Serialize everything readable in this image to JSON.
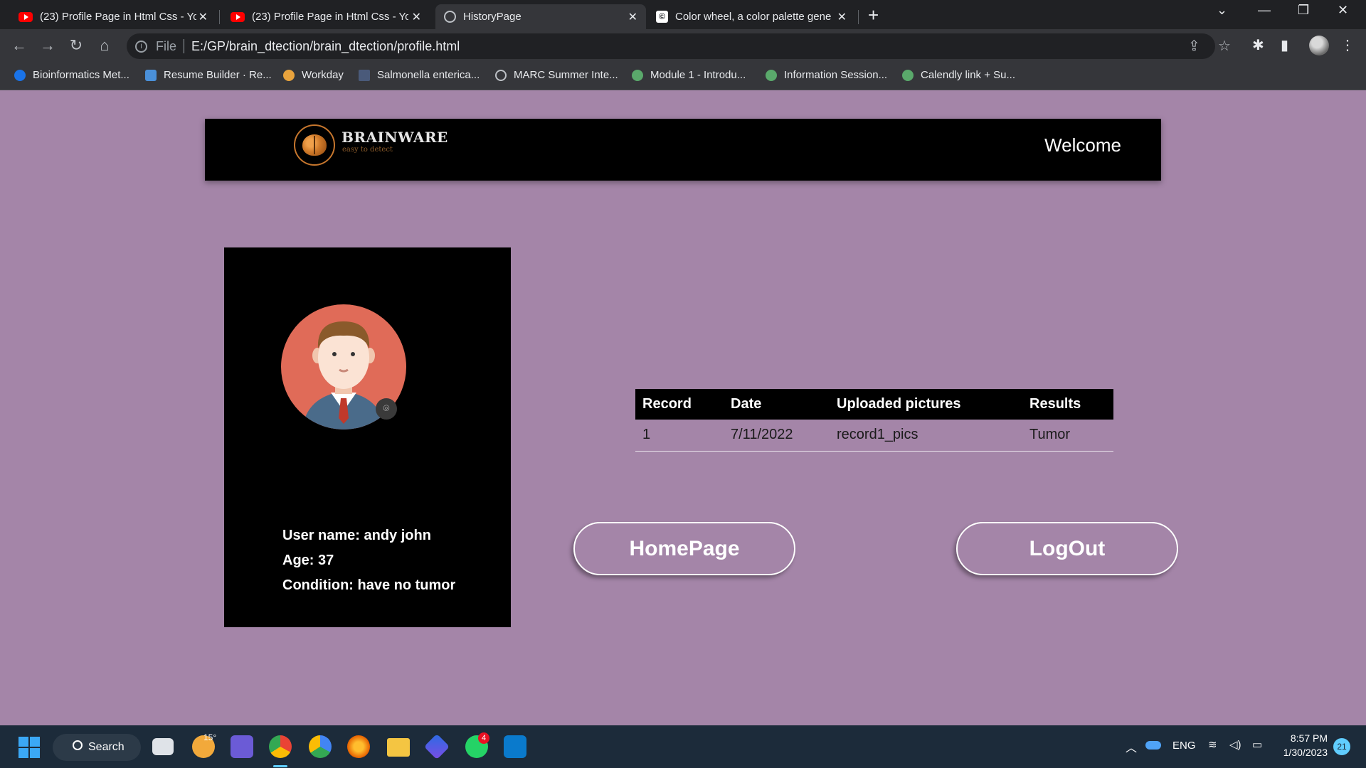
{
  "browser": {
    "tabs": [
      {
        "title": "(23) Profile Page in Html Css - Yo",
        "icon": "youtube-icon"
      },
      {
        "title": "(23) Profile Page in Html Css - Yo",
        "icon": "youtube-icon"
      },
      {
        "title": "HistoryPage",
        "icon": "globe-icon"
      },
      {
        "title": "Color wheel, a color palette gene",
        "icon": "color-wheel-icon"
      }
    ],
    "address": {
      "scheme": "File",
      "url": "E:/GP/brain_dtection/brain_dtection/profile.html"
    },
    "bookmarks": [
      "Bioinformatics Met...",
      "Resume Builder · Re...",
      "Workday",
      "Salmonella enterica...",
      "MARC Summer Inte...",
      "Module 1 - Introdu...",
      "Information Session...",
      "Calendly link + Su..."
    ]
  },
  "header": {
    "brand_name": "BRAINWARE",
    "tagline": "easy to detect",
    "welcome": "Welcome"
  },
  "profile": {
    "username": "User name: andy john",
    "age": "Age: 37",
    "condition": "Condition: have no tumor"
  },
  "records_table": {
    "columns": [
      "Record",
      "Date",
      "Uploaded pictures",
      "Results"
    ],
    "rows": [
      [
        "1",
        "7/11/2022",
        "record1_pics",
        "Tumor"
      ]
    ]
  },
  "buttons": {
    "home": "HomePage",
    "logout": "LogOut"
  },
  "taskbar": {
    "search_label": "Search",
    "weather": "15°",
    "whatsapp_badge": "4",
    "language": "ENG",
    "time": "8:57 PM",
    "date": "1/30/2023",
    "notification_count": "21"
  },
  "colors": {
    "page_background": "#a485a8",
    "header_background": "#000000",
    "brand_accent": "#c6762d",
    "avatar_background": "#e06b58"
  }
}
